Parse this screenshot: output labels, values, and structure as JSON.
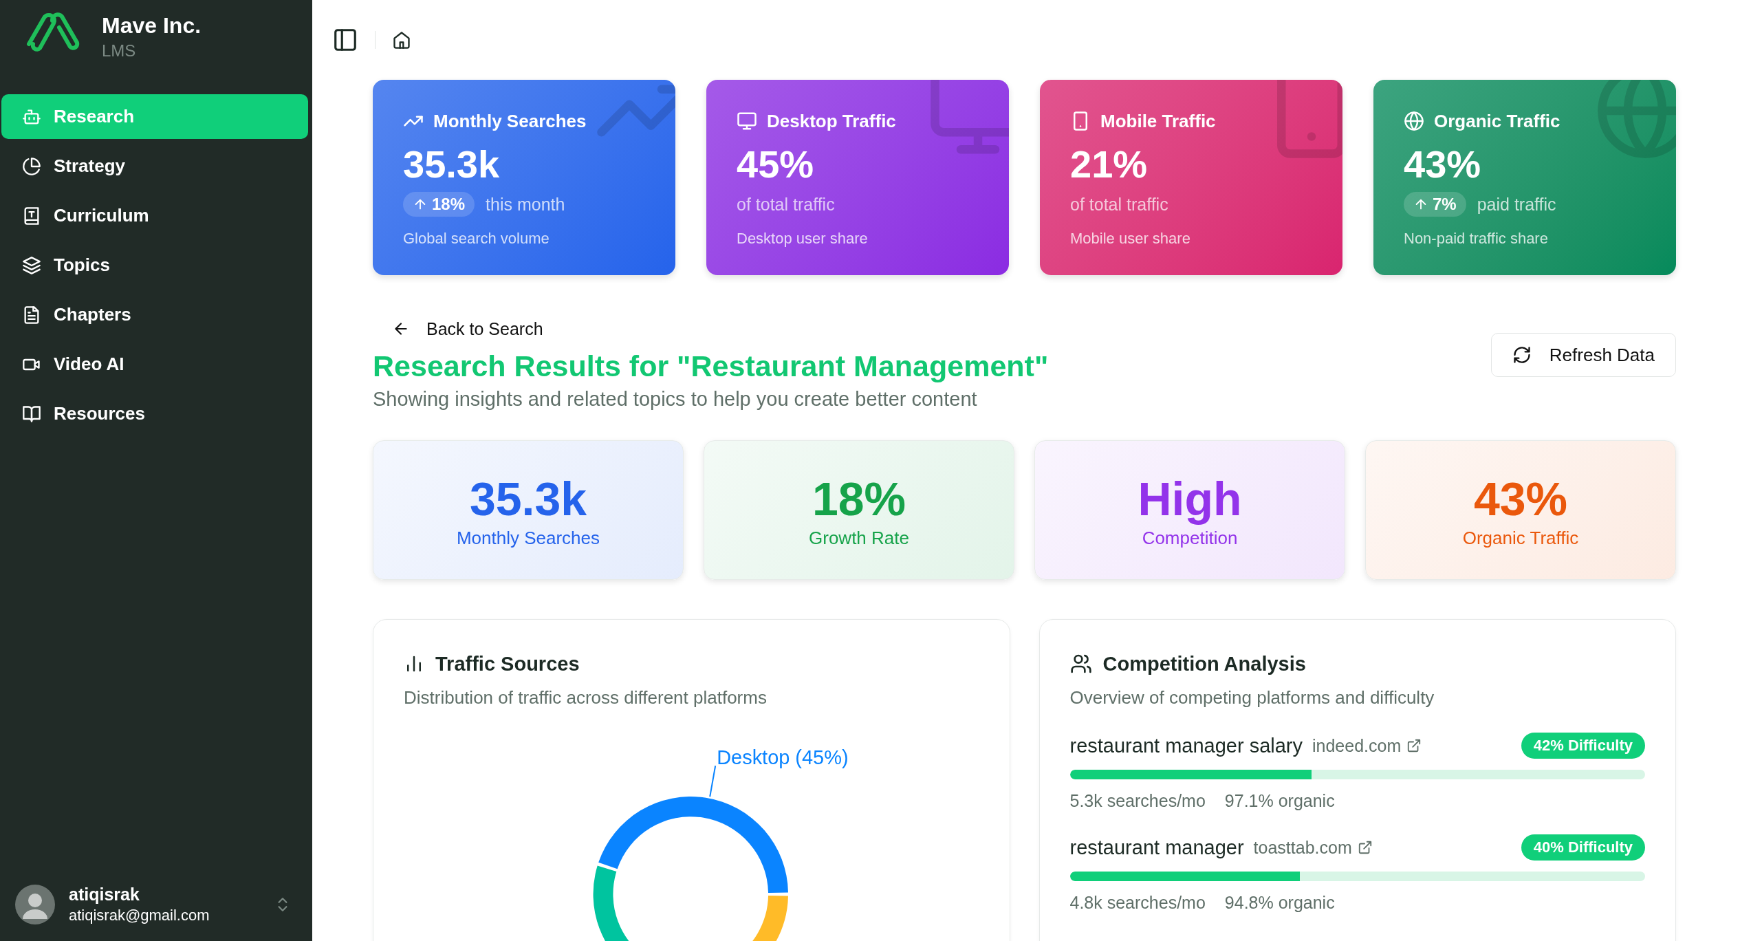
{
  "sidebar": {
    "brand": {
      "name": "Mave Inc.",
      "product": "LMS"
    },
    "nav": [
      {
        "label": "Research",
        "selected": true
      },
      {
        "label": "Strategy",
        "selected": false
      },
      {
        "label": "Curriculum",
        "selected": false
      },
      {
        "label": "Topics",
        "selected": false
      },
      {
        "label": "Chapters",
        "selected": false
      },
      {
        "label": "Video AI",
        "selected": false
      },
      {
        "label": "Resources",
        "selected": false
      }
    ],
    "user": {
      "name": "atiqisrak",
      "email": "atiqisrak@gmail.com"
    }
  },
  "metric_cards": [
    {
      "kind": "trend",
      "title": "Monthly Searches",
      "value": "35.3k",
      "change": "18%",
      "change_note": "this month",
      "footer": "Global search volume",
      "color": "#2563eb"
    },
    {
      "kind": "share",
      "title": "Desktop Traffic",
      "value": "45%",
      "subtitle": "of total traffic",
      "footer": "Desktop user share",
      "color": "#8b2be2"
    },
    {
      "kind": "share",
      "title": "Mobile Traffic",
      "value": "21%",
      "subtitle": "of total traffic",
      "footer": "Mobile user share",
      "color": "#d9246f"
    },
    {
      "kind": "trend",
      "title": "Organic Traffic",
      "value": "43%",
      "change": "7%",
      "change_note": "paid traffic",
      "footer": "Non-paid traffic share",
      "color": "#058a5b"
    }
  ],
  "back_link": "Back to Search",
  "heading": "Research Results for \"Restaurant Management\"",
  "subheading": "Showing insights and related topics to help you create better content",
  "refresh_button": "Refresh Data",
  "stats": [
    {
      "value": "35.3k",
      "label": "Monthly Searches",
      "color": "#2563eb"
    },
    {
      "value": "18%",
      "label": "Growth Rate",
      "color": "#16a34a"
    },
    {
      "value": "High",
      "label": "Competition",
      "color": "#9333ea"
    },
    {
      "value": "43%",
      "label": "Organic Traffic",
      "color": "#ea580c"
    }
  ],
  "traffic_sources": {
    "title": "Traffic Sources",
    "description": "Distribution of traffic across different platforms",
    "chart_label": "Desktop (45%)"
  },
  "competition": {
    "title": "Competition Analysis",
    "description": "Overview of competing platforms and difficulty",
    "competitors": [
      {
        "keyword": "restaurant manager salary",
        "domain": "indeed.com",
        "difficulty": "42% Difficulty",
        "level": 0.42,
        "searches": "5.3k searches/mo",
        "organic": "97.1% organic"
      },
      {
        "keyword": "restaurant manager",
        "domain": "toasttab.com",
        "difficulty": "40% Difficulty",
        "level": 0.4,
        "searches": "4.8k searches/mo",
        "organic": "94.8% organic"
      }
    ]
  }
}
